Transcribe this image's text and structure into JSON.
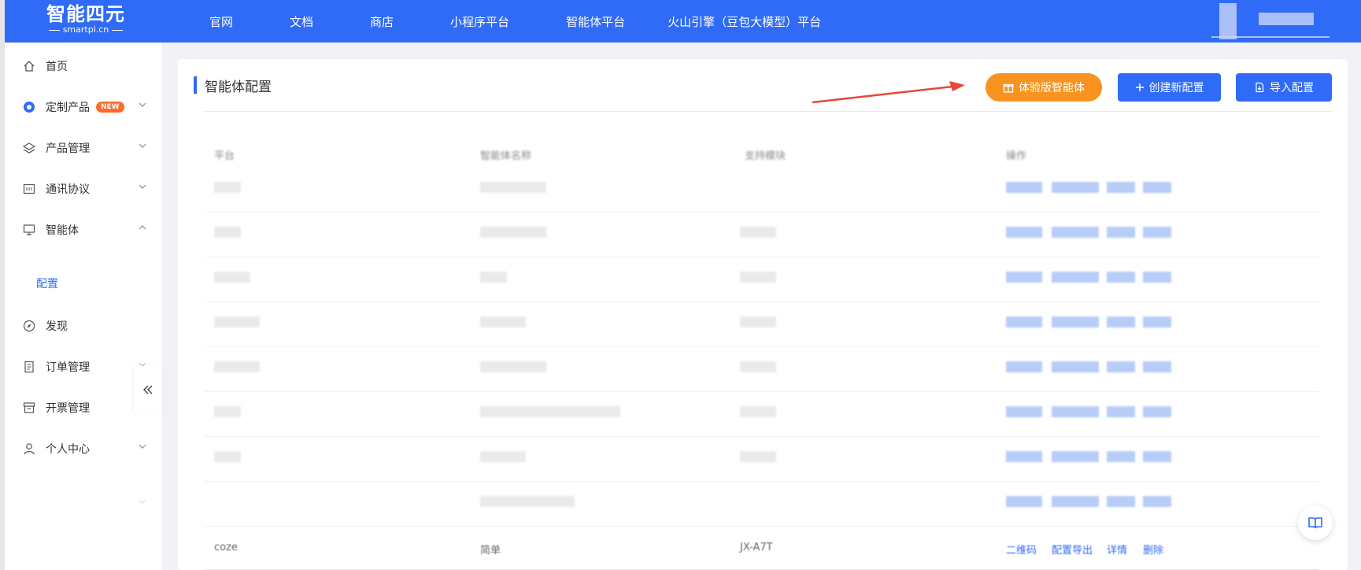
{
  "header": {
    "logo_name": "智能四元",
    "logo_sub": "smartpi.cn",
    "nav": [
      "官网",
      "文档",
      "商店",
      "小程序平台",
      "智能体平台",
      "火山引擎（豆包大模型）平台"
    ]
  },
  "sidebar": {
    "items": [
      {
        "label": "首页",
        "icon": "home-icon"
      },
      {
        "label": "定制产品",
        "icon": "custom-product-icon",
        "badge": "NEW"
      },
      {
        "label": "产品管理",
        "icon": "layers-icon"
      },
      {
        "label": "通讯协议",
        "icon": "protocol-icon"
      },
      {
        "label": "智能体",
        "icon": "monitor-icon"
      },
      {
        "label": "发现",
        "icon": "compass-icon"
      },
      {
        "label": "订单管理",
        "icon": "order-icon"
      },
      {
        "label": "开票管理",
        "icon": "invoice-icon"
      },
      {
        "label": "个人中心",
        "icon": "user-icon"
      }
    ],
    "sub_item": "配置"
  },
  "main": {
    "title": "智能体配置",
    "buttons": {
      "trial": "体验版智能体",
      "create": "创建新配置",
      "import": "导入配置"
    },
    "table": {
      "headers": [
        "平台",
        "智能体名称",
        "支持模块",
        "操作"
      ],
      "last_row": {
        "platform": "coze",
        "name": "简单",
        "module": "JX-A7T",
        "ops": [
          "二维码",
          "配置导出",
          "详情",
          "删除"
        ]
      }
    }
  },
  "colors": {
    "primary": "#2f6bf7",
    "accent": "#f7931e",
    "badge": "#ff6a2a"
  }
}
